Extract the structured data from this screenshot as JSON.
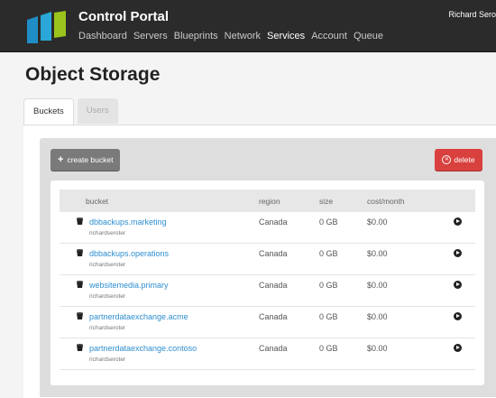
{
  "header": {
    "app_title": "Control Portal",
    "user": "Richard Sero",
    "nav": [
      {
        "label": "Dashboard",
        "active": false
      },
      {
        "label": "Servers",
        "active": false
      },
      {
        "label": "Blueprints",
        "active": false
      },
      {
        "label": "Network",
        "active": false
      },
      {
        "label": "Services",
        "active": true
      },
      {
        "label": "Account",
        "active": false
      },
      {
        "label": "Queue",
        "active": false
      }
    ],
    "logo_colors": [
      "#1f8ec7",
      "#2aa7d6",
      "#9bc41c"
    ]
  },
  "page": {
    "title": "Object Storage",
    "tabs": [
      {
        "label": "Buckets",
        "active": true
      },
      {
        "label": "Users",
        "active": false
      }
    ]
  },
  "toolbar": {
    "create_label": "create bucket",
    "delete_label": "delete"
  },
  "table": {
    "columns": [
      "bucket",
      "region",
      "size",
      "cost/month"
    ],
    "rows": [
      {
        "name": "dbbackups.marketing",
        "owner": "richardseroter",
        "region": "Canada",
        "size": "0 GB",
        "cost": "$0.00"
      },
      {
        "name": "dbbackups.operations",
        "owner": "richardseroter",
        "region": "Canada",
        "size": "0 GB",
        "cost": "$0.00"
      },
      {
        "name": "websitemedia.primary",
        "owner": "richardseroter",
        "region": "Canada",
        "size": "0 GB",
        "cost": "$0.00"
      },
      {
        "name": "partnerdataexchange.acme",
        "owner": "richardseroter",
        "region": "Canada",
        "size": "0 GB",
        "cost": "$0.00"
      },
      {
        "name": "partnerdataexchange.contoso",
        "owner": "richardseroter",
        "region": "Canada",
        "size": "0 GB",
        "cost": "$0.00"
      }
    ]
  },
  "colors": {
    "header_bg": "#2b2b2b",
    "link": "#2e8fcf",
    "delete": "#d9413e",
    "create": "#7a7a7a"
  }
}
